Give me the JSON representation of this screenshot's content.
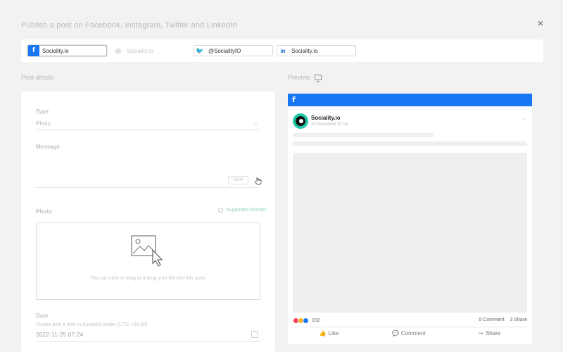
{
  "header": {
    "title": "Publish a post on Facebook, Instagram, Twitter and LinkedIn",
    "close_glyph": "×"
  },
  "accounts": [
    {
      "network": "facebook",
      "label": "Sociality.io",
      "icon": "f",
      "active": true
    },
    {
      "network": "instagram",
      "label": "Sociality.io",
      "icon": "◎",
      "active": false
    },
    {
      "network": "twitter",
      "label": "@SocialityIO",
      "icon": "🐦",
      "active": false
    },
    {
      "network": "linkedin",
      "label": "Sociality.io",
      "icon": "in",
      "active": false
    }
  ],
  "editor": {
    "section_title": "Post details",
    "type_label": "Type",
    "type_value": "Photo",
    "message_label": "Message",
    "char_count": "5000",
    "photo_label": "Photo",
    "specs_link": "Supported formats",
    "dropzone_hint": "You can click or drag and drop your file into this area.",
    "date_label": "Date",
    "date_hint": "Please pick a time in Europe/London (UTC +00:00)",
    "date_value": "2022-11-25 07:24"
  },
  "preview": {
    "section_title": "Preview",
    "bar_icon": "f",
    "page_name": "Sociality.io",
    "post_time": "25 November 07:24",
    "reaction_count": "152",
    "comment_count": "9 Comment",
    "share_count": "3 Share",
    "like_label": "Like",
    "comment_label": "Comment",
    "share_label": "Share"
  },
  "colors": {
    "facebook_blue": "#1877f2",
    "twitter_blue": "#1da1f2",
    "linkedin_blue": "#0a66c2",
    "accent_teal": "#21c8a6"
  }
}
